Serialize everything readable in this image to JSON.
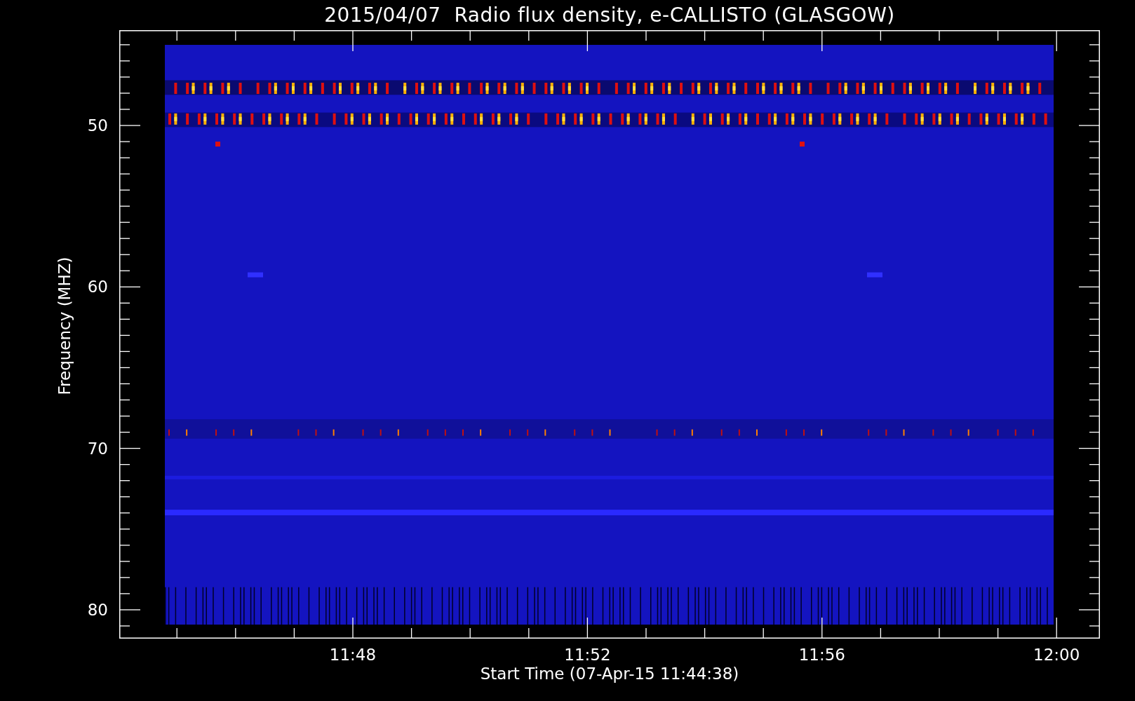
{
  "title": "2015/04/07  Radio flux density, e-CALLISTO (GLASGOW)",
  "y_axis": {
    "label": "Frequency (MHZ)",
    "ticks": [
      "50",
      "60",
      "70",
      "80"
    ]
  },
  "x_axis": {
    "label": "Start Time (07-Apr-15 11:44:38)",
    "ticks": [
      "11:48",
      "11:52",
      "11:56",
      "12:00"
    ]
  }
}
